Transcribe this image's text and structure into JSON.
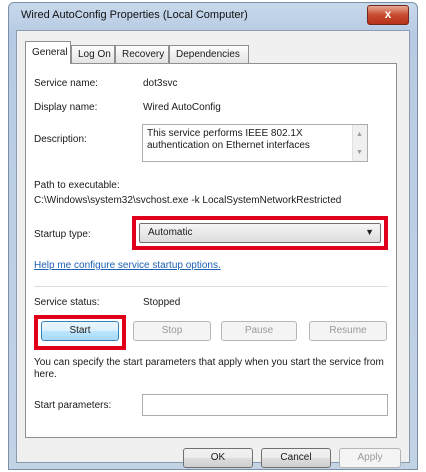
{
  "window": {
    "title": "Wired AutoConfig Properties (Local Computer)",
    "close_label": "x"
  },
  "tabs": [
    {
      "label": "General"
    },
    {
      "label": "Log On"
    },
    {
      "label": "Recovery"
    },
    {
      "label": "Dependencies"
    }
  ],
  "general": {
    "service_name_label": "Service name:",
    "service_name_value": "dot3svc",
    "display_name_label": "Display name:",
    "display_name_value": "Wired AutoConfig",
    "description_label": "Description:",
    "description_value": "This service performs IEEE 802.1X authentication on Ethernet interfaces",
    "path_label": "Path to executable:",
    "path_value": "C:\\Windows\\system32\\svchost.exe -k LocalSystemNetworkRestricted",
    "startup_type_label": "Startup type:",
    "startup_type_value": "Automatic",
    "help_link": "Help me configure service startup options.",
    "service_status_label": "Service status:",
    "service_status_value": "Stopped",
    "start_label": "Start",
    "stop_label": "Stop",
    "pause_label": "Pause",
    "resume_label": "Resume",
    "hint_text": "You can specify the start parameters that apply when you start the service from here.",
    "start_params_label": "Start parameters:",
    "start_params_value": ""
  },
  "footer": {
    "ok_label": "OK",
    "cancel_label": "Cancel",
    "apply_label": "Apply"
  },
  "colors": {
    "highlight": "#e0001b",
    "link": "#1e5fb4"
  }
}
